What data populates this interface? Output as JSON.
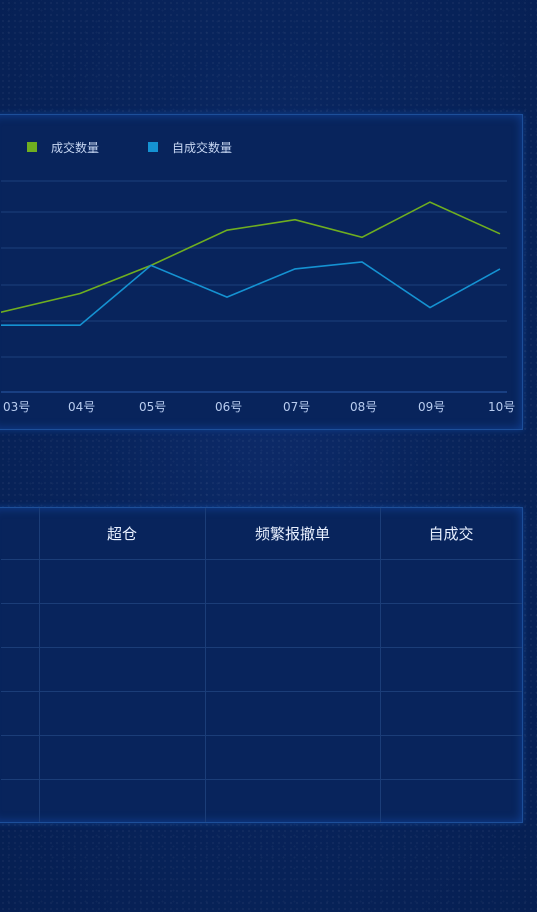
{
  "chart_data": {
    "type": "line",
    "categories": [
      "03号",
      "04号",
      "05号",
      "06号",
      "07号",
      "08号",
      "09号",
      "10号"
    ],
    "series": [
      {
        "name": "成交数量",
        "color": "#6fae20",
        "values": [
          34.0,
          38.0,
          43.0,
          44.5,
          42.0,
          47.0,
          42.5
        ]
      },
      {
        "name": "自成交数量",
        "color": "#1592d2",
        "values": [
          29.5,
          29.5,
          38.0,
          33.5,
          37.5,
          38.5,
          32.0,
          37.5
        ]
      }
    ],
    "grid": true,
    "legend_position": "top-left"
  },
  "table": {
    "headers": [
      "",
      "超仓",
      "频繁报撤单",
      "自成交"
    ],
    "rows": [
      [
        "",
        "",
        "",
        ""
      ],
      [
        "",
        "",
        "",
        ""
      ],
      [
        "",
        "",
        "",
        ""
      ],
      [
        "",
        "",
        "",
        ""
      ],
      [
        "",
        "",
        "",
        ""
      ],
      [
        "",
        "",
        "",
        ""
      ]
    ]
  }
}
